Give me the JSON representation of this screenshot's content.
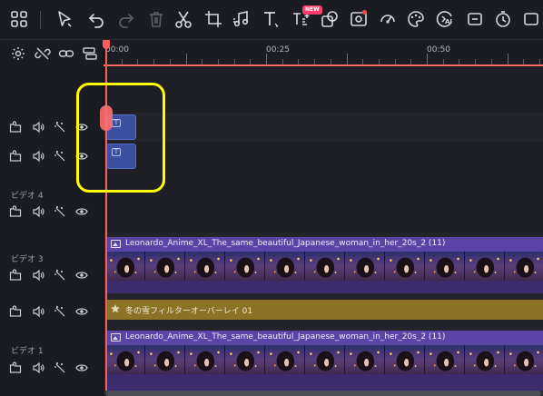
{
  "toolbar": {
    "icons": [
      "grid-icon",
      "pointer-icon",
      "undo-icon",
      "redo-icon",
      "delete-icon",
      "cut-icon",
      "crop-icon",
      "audio-icon",
      "text-icon",
      "tts-icon",
      "shape-icon",
      "record-icon",
      "speed-icon",
      "color-icon",
      "ai-icon",
      "timer-icon",
      "more-icon"
    ],
    "new_badge": "NEW",
    "ai_label": "AI"
  },
  "ruler": {
    "labels": [
      "00:00",
      "00:25",
      "00:50"
    ]
  },
  "tracks": [
    {
      "id": "t1",
      "name": ""
    },
    {
      "id": "t2",
      "name": ""
    },
    {
      "id": "t3",
      "name": "ビデオ 4"
    },
    {
      "id": "t4",
      "name": "ビデオ 3"
    },
    {
      "id": "t5",
      "name": ""
    },
    {
      "id": "t6",
      "name": "ビデオ 1"
    }
  ],
  "clips": {
    "title_clip_icon": "T",
    "video_clip_upper": "Leonardo_Anime_XL_The_same_beautiful_Japanese_woman_in_her_20s_2 (11)",
    "effect_clip": "冬の雪フィルターオーバーレイ 01",
    "video_clip_lower": "Leonardo_Anime_XL_The_same_beautiful_Japanese_woman_in_her_20s_2 (11)"
  },
  "colors": {
    "playhead": "#ff5d5d",
    "highlight": "#ffff00",
    "title_clip": "#3a4f9e",
    "video_clip": "#4b3a8a",
    "effect_clip": "#8c7226"
  }
}
